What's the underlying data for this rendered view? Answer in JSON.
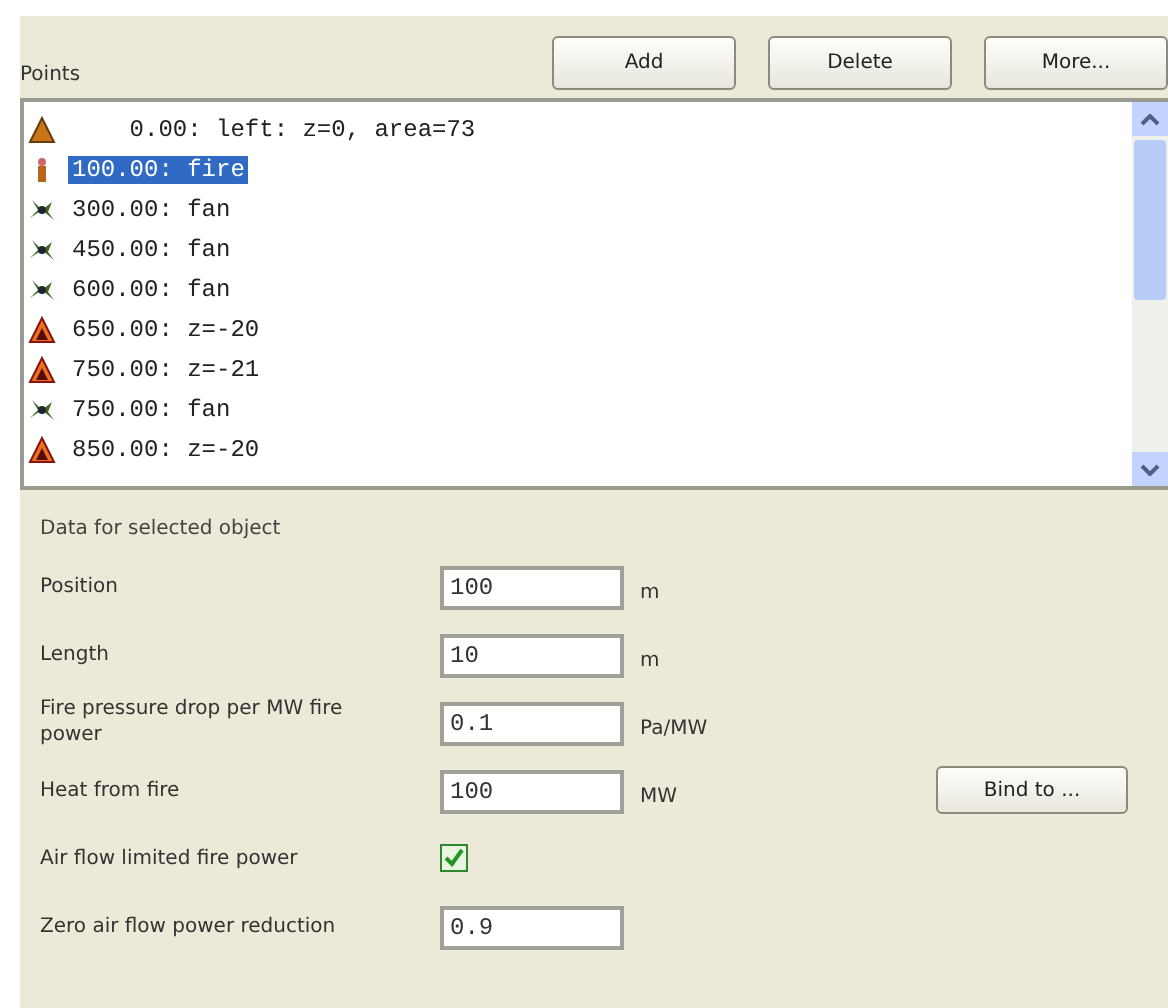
{
  "points": {
    "title": "Points",
    "buttons": [
      "Add",
      "Delete",
      "More..."
    ],
    "items": [
      {
        "kind": "portal",
        "text": "    0.00: left: z=0, area=73",
        "selected": false
      },
      {
        "kind": "fire",
        "text": "100.00: fire",
        "selected": true
      },
      {
        "kind": "fan",
        "text": "300.00: fan",
        "selected": false
      },
      {
        "kind": "fan",
        "text": "450.00: fan",
        "selected": false
      },
      {
        "kind": "fan",
        "text": "600.00: fan",
        "selected": false
      },
      {
        "kind": "slope",
        "text": "650.00: z=-20",
        "selected": false
      },
      {
        "kind": "slope",
        "text": "750.00: z=-21",
        "selected": false
      },
      {
        "kind": "fan",
        "text": "750.00: fan",
        "selected": false
      },
      {
        "kind": "slope",
        "text": "850.00: z=-20",
        "selected": false
      }
    ]
  },
  "details": {
    "title": "Data for selected object",
    "fields": [
      {
        "kind": "text",
        "label": "Position",
        "value": "100",
        "unit": "m"
      },
      {
        "kind": "text",
        "label": "Length",
        "value": "10",
        "unit": "m"
      },
      {
        "kind": "text",
        "label": "Fire pressure drop per MW fire power",
        "value": "0.1",
        "unit": "Pa/MW"
      },
      {
        "kind": "text",
        "label": "Heat from fire",
        "value": "100",
        "unit": "MW",
        "button": "Bind to ..."
      },
      {
        "kind": "checkbox",
        "label": "Air flow limited fire power",
        "checked": true
      },
      {
        "kind": "text",
        "label": "Zero air flow power reduction",
        "value": "0.9"
      }
    ]
  }
}
